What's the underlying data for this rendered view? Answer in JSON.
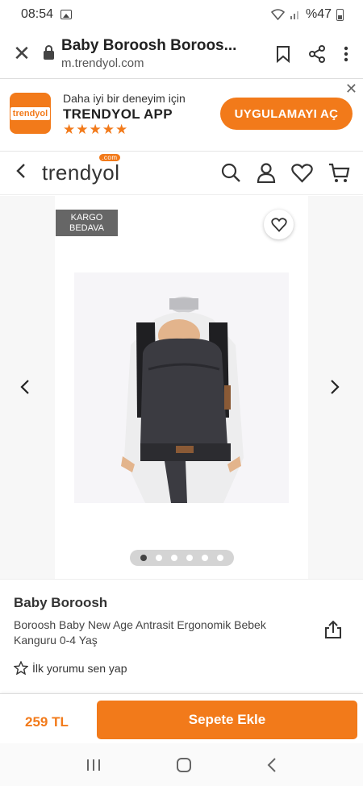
{
  "status_bar": {
    "time": "08:54",
    "battery": "%47"
  },
  "browser": {
    "title": "Baby Boroosh Boroos...",
    "domain": "m.trendyol.com"
  },
  "app_banner": {
    "subtitle": "Daha iyi bir deneyim için",
    "app_name": "TRENDYOL APP",
    "logo_text": "trendyol",
    "rating_stars": "★★★★★",
    "open_button": "UYGULAMAYI AÇ"
  },
  "site_header": {
    "logo": "trendyol",
    "logo_badge": ".com"
  },
  "gallery": {
    "badge_line1": "KARGO",
    "badge_line2": "BEDAVA",
    "image_count": 6,
    "active_index": 0
  },
  "product": {
    "brand": "Baby Boroosh",
    "name": "Boroosh Baby New Age Antrasit Ergonomik Bebek Kanguru 0-4 Yaş",
    "review_text": "İlk yorumu sen yap"
  },
  "purchase": {
    "price": "259 TL",
    "add_to_cart": "Sepete Ekle"
  },
  "colors": {
    "accent": "#f27a1a",
    "badge_bg": "#666666"
  }
}
